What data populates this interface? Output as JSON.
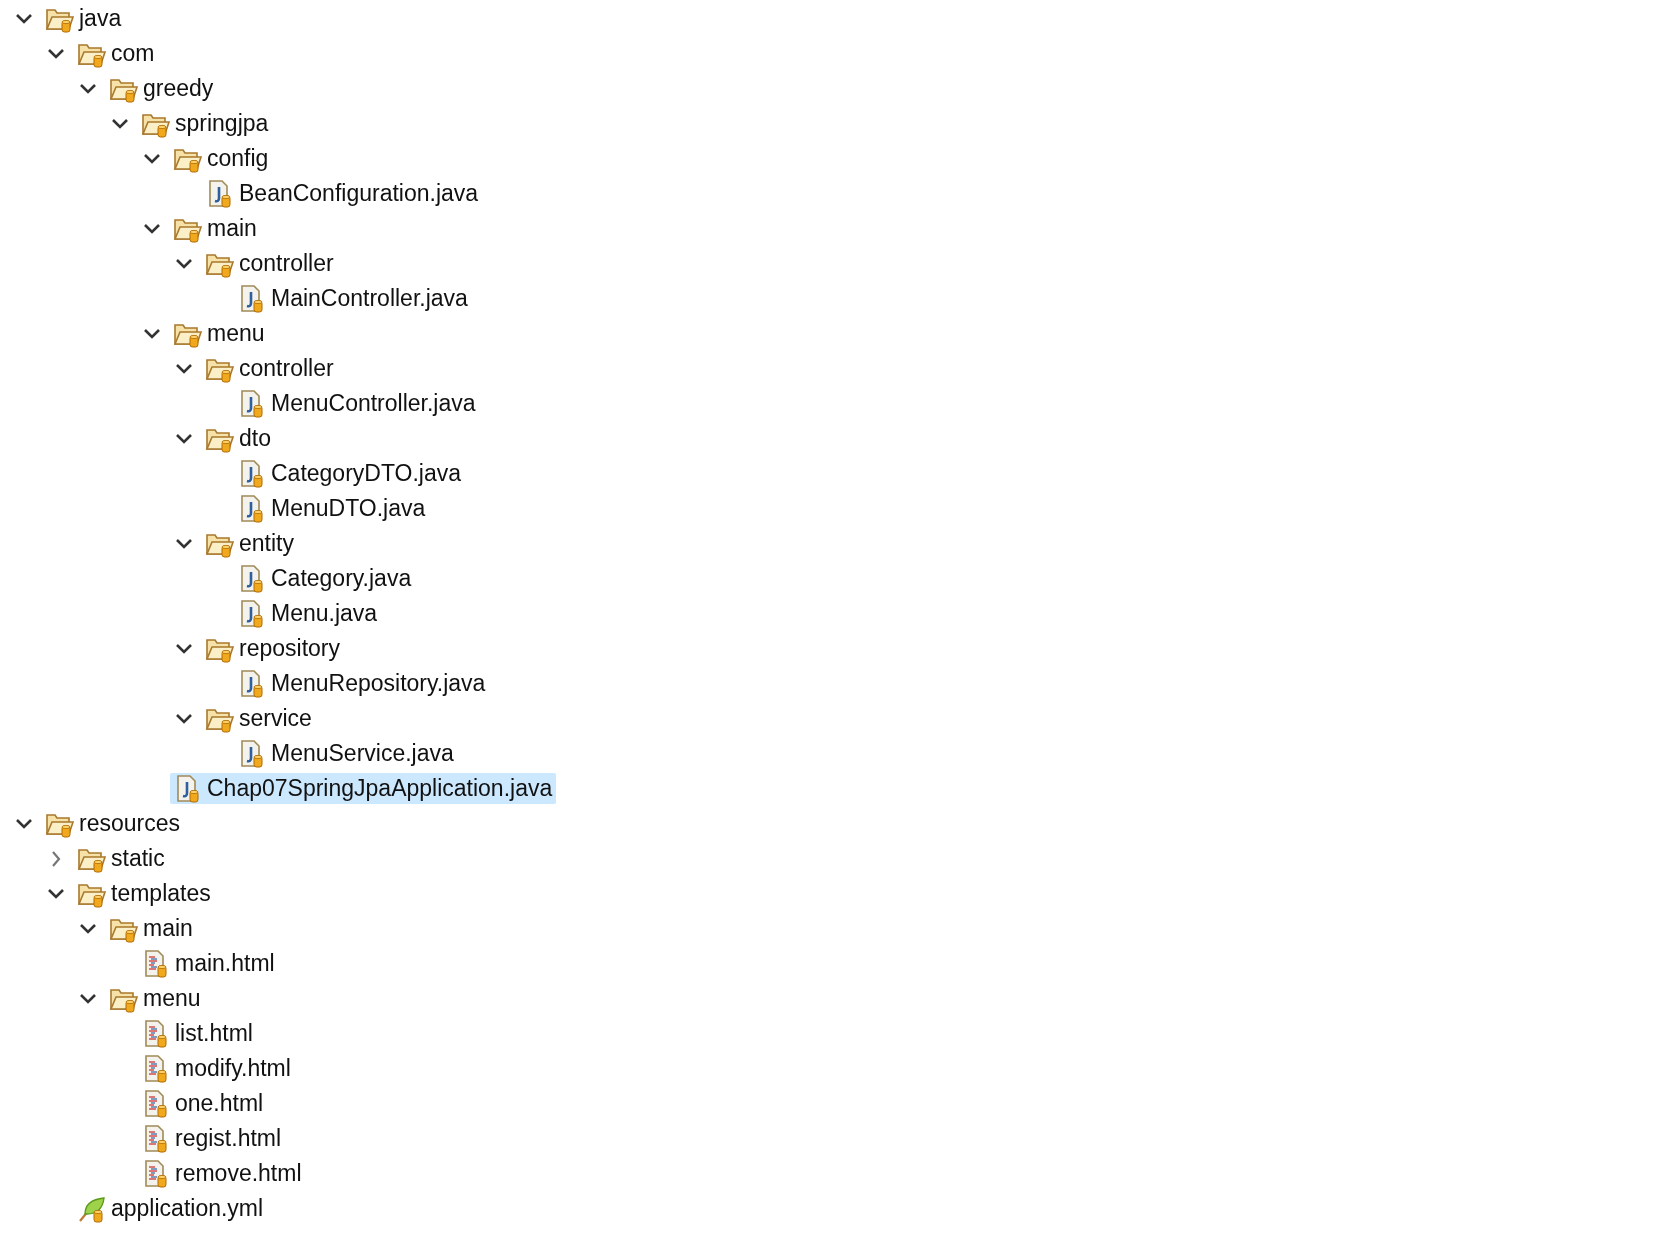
{
  "tree": [
    {
      "kind": "folder",
      "label": "java",
      "expanded": true,
      "selected": false,
      "children": [
        {
          "kind": "folder",
          "label": "com",
          "expanded": true,
          "selected": false,
          "children": [
            {
              "kind": "folder",
              "label": "greedy",
              "expanded": true,
              "selected": false,
              "children": [
                {
                  "kind": "folder",
                  "label": "springjpa",
                  "expanded": true,
                  "selected": false,
                  "children": [
                    {
                      "kind": "folder",
                      "label": "config",
                      "expanded": true,
                      "selected": false,
                      "children": [
                        {
                          "kind": "java",
                          "label": "BeanConfiguration.java",
                          "selected": false
                        }
                      ]
                    },
                    {
                      "kind": "folder",
                      "label": "main",
                      "expanded": true,
                      "selected": false,
                      "children": [
                        {
                          "kind": "folder",
                          "label": "controller",
                          "expanded": true,
                          "selected": false,
                          "children": [
                            {
                              "kind": "java",
                              "label": "MainController.java",
                              "selected": false
                            }
                          ]
                        }
                      ]
                    },
                    {
                      "kind": "folder",
                      "label": "menu",
                      "expanded": true,
                      "selected": false,
                      "children": [
                        {
                          "kind": "folder",
                          "label": "controller",
                          "expanded": true,
                          "selected": false,
                          "children": [
                            {
                              "kind": "java",
                              "label": "MenuController.java",
                              "selected": false
                            }
                          ]
                        },
                        {
                          "kind": "folder",
                          "label": "dto",
                          "expanded": true,
                          "selected": false,
                          "children": [
                            {
                              "kind": "java",
                              "label": "CategoryDTO.java",
                              "selected": false
                            },
                            {
                              "kind": "java",
                              "label": "MenuDTO.java",
                              "selected": false
                            }
                          ]
                        },
                        {
                          "kind": "folder",
                          "label": "entity",
                          "expanded": true,
                          "selected": false,
                          "children": [
                            {
                              "kind": "java",
                              "label": "Category.java",
                              "selected": false
                            },
                            {
                              "kind": "java",
                              "label": "Menu.java",
                              "selected": false
                            }
                          ]
                        },
                        {
                          "kind": "folder",
                          "label": "repository",
                          "expanded": true,
                          "selected": false,
                          "children": [
                            {
                              "kind": "java",
                              "label": "MenuRepository.java",
                              "selected": false
                            }
                          ]
                        },
                        {
                          "kind": "folder",
                          "label": "service",
                          "expanded": true,
                          "selected": false,
                          "children": [
                            {
                              "kind": "java",
                              "label": "MenuService.java",
                              "selected": false
                            }
                          ]
                        }
                      ]
                    },
                    {
                      "kind": "java",
                      "label": "Chap07SpringJpaApplication.java",
                      "selected": true
                    }
                  ]
                }
              ]
            }
          ]
        }
      ]
    },
    {
      "kind": "folder",
      "label": "resources",
      "expanded": true,
      "selected": false,
      "children": [
        {
          "kind": "folder",
          "label": "static",
          "expanded": false,
          "selected": false
        },
        {
          "kind": "folder",
          "label": "templates",
          "expanded": true,
          "selected": false,
          "children": [
            {
              "kind": "folder",
              "label": "main",
              "expanded": true,
              "selected": false,
              "children": [
                {
                  "kind": "html",
                  "label": "main.html",
                  "selected": false
                }
              ]
            },
            {
              "kind": "folder",
              "label": "menu",
              "expanded": true,
              "selected": false,
              "children": [
                {
                  "kind": "html",
                  "label": "list.html",
                  "selected": false
                },
                {
                  "kind": "html",
                  "label": "modify.html",
                  "selected": false
                },
                {
                  "kind": "html",
                  "label": "one.html",
                  "selected": false
                },
                {
                  "kind": "html",
                  "label": "regist.html",
                  "selected": false
                },
                {
                  "kind": "html",
                  "label": "remove.html",
                  "selected": false
                }
              ]
            }
          ]
        },
        {
          "kind": "yml",
          "label": "application.yml",
          "selected": false
        }
      ]
    }
  ]
}
